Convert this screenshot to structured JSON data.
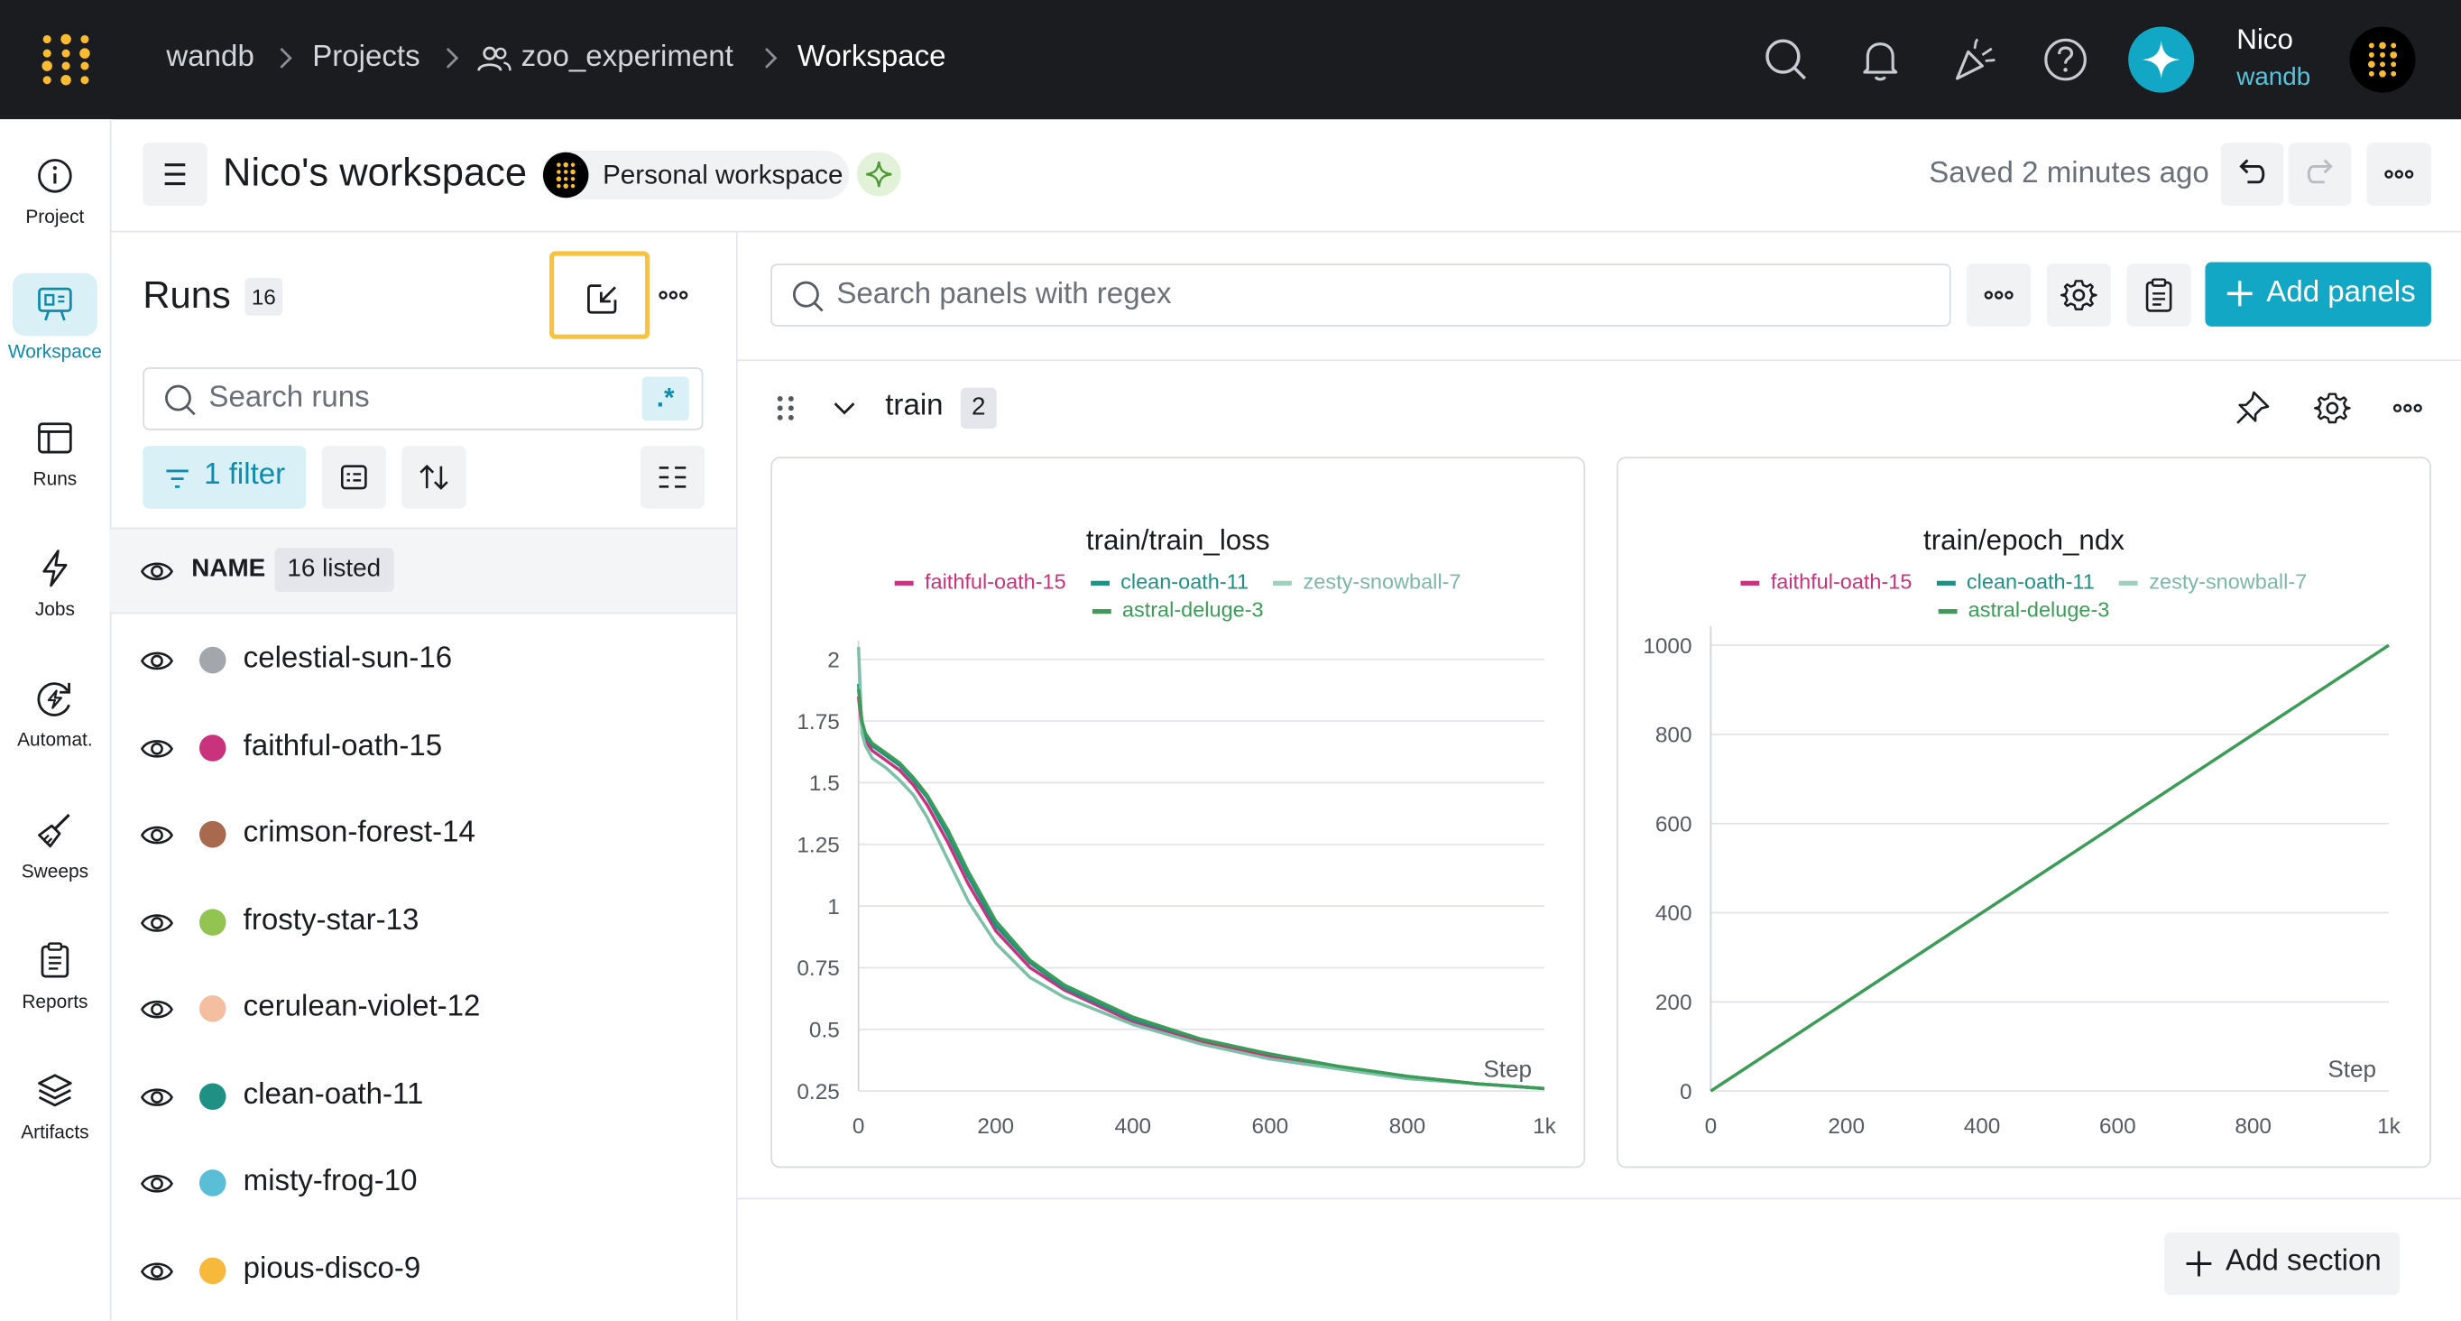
{
  "topbar": {
    "breadcrumb": [
      "wandb",
      "Projects",
      "zoo_experiment",
      "Workspace"
    ],
    "user_name": "Nico",
    "user_org": "wandb"
  },
  "nav": [
    {
      "label": "Project",
      "icon": "info-icon"
    },
    {
      "label": "Workspace",
      "icon": "workspace-icon",
      "active": true
    },
    {
      "label": "Runs",
      "icon": "runs-table-icon"
    },
    {
      "label": "Jobs",
      "icon": "lightning-icon"
    },
    {
      "label": "Automat.",
      "icon": "automation-icon"
    },
    {
      "label": "Sweeps",
      "icon": "broom-icon"
    },
    {
      "label": "Reports",
      "icon": "clipboard-icon"
    },
    {
      "label": "Artifacts",
      "icon": "layers-icon"
    }
  ],
  "header": {
    "title": "Nico's workspace",
    "workspace_type": "Personal workspace",
    "saved_status": "Saved 2 minutes ago"
  },
  "runs_panel": {
    "title": "Runs",
    "count": "16",
    "search_placeholder": "Search runs",
    "regex_label": ".*",
    "filter_label": "1 filter",
    "column_header": "NAME",
    "listed_badge": "16 listed",
    "runs": [
      {
        "name": "celestial-sun-16",
        "color": "#a3a6ab"
      },
      {
        "name": "faithful-oath-15",
        "color": "#c9337d"
      },
      {
        "name": "crimson-forest-14",
        "color": "#a9694f"
      },
      {
        "name": "frosty-star-13",
        "color": "#93c452"
      },
      {
        "name": "cerulean-violet-12",
        "color": "#f3bfa0"
      },
      {
        "name": "clean-oath-11",
        "color": "#1f9184"
      },
      {
        "name": "misty-frog-10",
        "color": "#58bfd6"
      },
      {
        "name": "pious-disco-9",
        "color": "#f6b93b"
      }
    ]
  },
  "panels_area": {
    "search_placeholder": "Search panels with regex",
    "add_panels_label": "Add panels",
    "section_name": "train",
    "section_count": "2",
    "add_section_label": "Add section"
  },
  "chart_data": [
    {
      "type": "line",
      "title": "train/train_loss",
      "xlabel": "Step",
      "ylabel": "",
      "xlim": [
        0,
        1000
      ],
      "ylim": [
        0.25,
        2
      ],
      "x_ticks": [
        "0",
        "200",
        "400",
        "600",
        "800",
        "1k"
      ],
      "y_ticks": [
        "0.25",
        "0.5",
        "0.75",
        "1",
        "1.25",
        "1.5",
        "1.75",
        "2"
      ],
      "legend": [
        "faithful-oath-15",
        "clean-oath-11",
        "zesty-snowball-7",
        "astral-deluge-3"
      ],
      "series": [
        {
          "name": "faithful-oath-15",
          "color": "#c9337d",
          "x": [
            0,
            5,
            10,
            20,
            40,
            60,
            80,
            100,
            130,
            160,
            200,
            250,
            300,
            400,
            500,
            600,
            700,
            800,
            900,
            1000
          ],
          "y": [
            1.85,
            1.72,
            1.67,
            1.63,
            1.59,
            1.55,
            1.49,
            1.41,
            1.26,
            1.09,
            0.9,
            0.75,
            0.66,
            0.53,
            0.45,
            0.39,
            0.35,
            0.31,
            0.28,
            0.26
          ]
        },
        {
          "name": "clean-oath-11",
          "color": "#1f9184",
          "x": [
            0,
            5,
            10,
            20,
            40,
            60,
            80,
            100,
            130,
            160,
            200,
            250,
            300,
            400,
            500,
            600,
            700,
            800,
            900,
            1000
          ],
          "y": [
            1.9,
            1.74,
            1.69,
            1.65,
            1.61,
            1.57,
            1.51,
            1.44,
            1.29,
            1.12,
            0.92,
            0.77,
            0.67,
            0.54,
            0.46,
            0.4,
            0.35,
            0.31,
            0.28,
            0.26
          ]
        },
        {
          "name": "zesty-snowball-7",
          "color": "#7cc0a8",
          "x": [
            0,
            5,
            10,
            20,
            40,
            60,
            80,
            100,
            130,
            160,
            200,
            250,
            300,
            400,
            500,
            600,
            700,
            800,
            900,
            1000
          ],
          "y": [
            2.05,
            1.7,
            1.65,
            1.6,
            1.56,
            1.51,
            1.45,
            1.36,
            1.19,
            1.02,
            0.85,
            0.71,
            0.63,
            0.52,
            0.44,
            0.38,
            0.34,
            0.3,
            0.28,
            0.26
          ]
        },
        {
          "name": "astral-deluge-3",
          "color": "#3b9c57",
          "x": [
            0,
            5,
            10,
            20,
            40,
            60,
            80,
            100,
            130,
            160,
            200,
            250,
            300,
            400,
            500,
            600,
            700,
            800,
            900,
            1000
          ],
          "y": [
            1.88,
            1.75,
            1.7,
            1.66,
            1.62,
            1.58,
            1.52,
            1.45,
            1.31,
            1.14,
            0.94,
            0.78,
            0.68,
            0.55,
            0.46,
            0.4,
            0.35,
            0.31,
            0.28,
            0.26
          ]
        }
      ]
    },
    {
      "type": "line",
      "title": "train/epoch_ndx",
      "xlabel": "Step",
      "ylabel": "",
      "xlim": [
        0,
        1000
      ],
      "ylim": [
        0,
        1000
      ],
      "x_ticks": [
        "0",
        "200",
        "400",
        "600",
        "800",
        "1k"
      ],
      "y_ticks": [
        "0",
        "200",
        "400",
        "600",
        "800",
        "1000"
      ],
      "legend": [
        "faithful-oath-15",
        "clean-oath-11",
        "zesty-snowball-7",
        "astral-deluge-3"
      ],
      "series": [
        {
          "name": "astral-deluge-3",
          "color": "#3b9c57",
          "x": [
            0,
            1000
          ],
          "y": [
            0,
            1000
          ]
        }
      ]
    }
  ]
}
